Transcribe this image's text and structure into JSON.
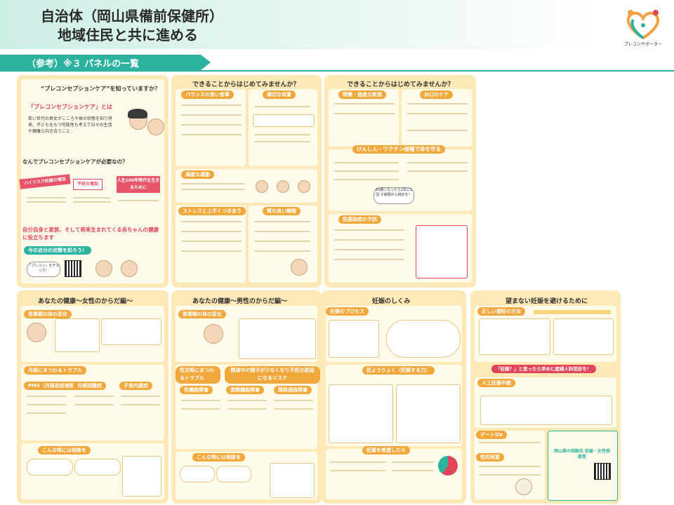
{
  "header": {
    "title_line1": "自治体（岡山県備前保健所）",
    "title_line2": "地域住民と共に進める",
    "logo_text": "プレコンサポーター"
  },
  "section": {
    "label": "（参考）※３ パネルの一覧"
  },
  "colors": {
    "accent": "#2bb3a0",
    "panel": "#fde9b6",
    "orange": "#f2a73b",
    "red": "#e0455a"
  },
  "panels": {
    "p1": {
      "title": "“プレコンセプションケア”を知っていますか？",
      "box_heading": "「プレコンセプションケア」とは",
      "box_text": "若い世代の男女がこころや体の状態を知り将来、子どもをもつ可能性も考えて日々の生活や健康と向き合うこと",
      "question": "なんでプレコンセプションケアが必要なの？",
      "tags": [
        "ハイリスク妊娠の増加",
        "不妊の増加",
        "人生100年時代を生きるために"
      ],
      "message": "自分自身と家族、そして将来生まれてくる赤ちゃんの健康に役立ちます",
      "check": "今の自分の状態を知ろう！",
      "bubble": "「プレコン」をチェック！"
    },
    "p2": {
      "title": "できることからはじめてみませんか？",
      "pills": [
        "バランスの良い食事",
        "適切な体重",
        "適度な運動",
        "ストレスと上手くつきあう",
        "質の良い睡眠"
      ]
    },
    "p3": {
      "title": "できることからはじめてみませんか？",
      "pills": [
        "喫煙・過度な飲酒",
        "お口のケア",
        "けんしん・ワクチン接種で命を守る",
        "性感染症の予防"
      ],
      "vaccine_label": "20歳になったら2年に1回 子宮頸がん検診を！"
    },
    "p4": {
      "title": "あなたの健康～女性のからだ編～",
      "pills": [
        "思春期の体の変化",
        "月経にまつわるトラブル",
        "PMS（月経前症候群）",
        "月経困難症",
        "子宮内膜症",
        "こんな時には相談を"
      ]
    },
    "p5": {
      "title": "あなたの健康～男性のからだ編～",
      "pills": [
        "思春期の体の変化",
        "性交時にまつわるトラブル",
        "精液中の精子が少なくなり不妊の原因になるリスク",
        "性機能障害",
        "造精機能障害",
        "精路通過障害",
        "こんな時には相談を"
      ]
    },
    "p6": {
      "title": "妊娠のしくみ",
      "pills": [
        "妊娠のプロセス",
        "妊ようりょく（妊娠する力）",
        "妊娠を希望したら"
      ]
    },
    "p7": {
      "title": "望まない妊娠を避けるために",
      "pills": [
        "正しい避妊の方法",
        "「妊娠？」と思ったら早めに産婦人科受診を！",
        "人工妊娠中絶",
        "デートDV",
        "性的同意"
      ],
      "consult": "岡山県の相談先 妊娠・女性相談室"
    }
  }
}
